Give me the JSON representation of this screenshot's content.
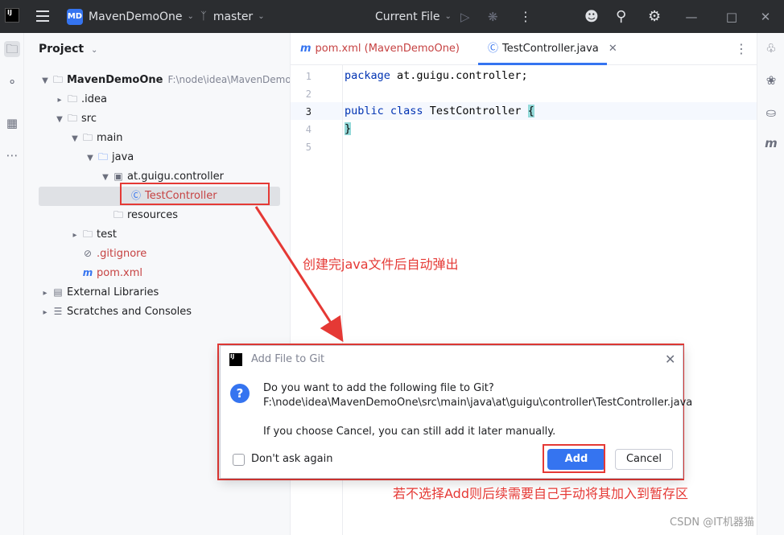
{
  "titlebar": {
    "app_badge": "MD",
    "project_name": "MavenDemoOne",
    "vcs_branch": "master",
    "run_config": "Current File",
    "icons": [
      "hamburger-icon",
      "branch-icon",
      "run-icon",
      "debug-icon",
      "more-icon",
      "add-user-icon",
      "search-icon",
      "gear-icon",
      "minimize-icon",
      "maximize-icon",
      "close-icon"
    ]
  },
  "project_pane": {
    "title": "Project",
    "tree": [
      {
        "label": "MavenDemoOne",
        "hint": "F:\\node\\idea\\MavenDemoOne"
      },
      {
        "label": ".idea"
      },
      {
        "label": "src"
      },
      {
        "label": "main"
      },
      {
        "label": "java"
      },
      {
        "label": "at.guigu.controller"
      },
      {
        "label": "TestController"
      },
      {
        "label": "resources"
      },
      {
        "label": "test"
      },
      {
        "label": ".gitignore"
      },
      {
        "label": "pom.xml"
      },
      {
        "label": "External Libraries"
      },
      {
        "label": "Scratches and Consoles"
      }
    ]
  },
  "editor": {
    "tabs": [
      {
        "label": "pom.xml (MavenDemoOne)"
      },
      {
        "label": "TestController.java"
      }
    ],
    "line_numbers": [
      "1",
      "2",
      "3",
      "4",
      "5"
    ],
    "lines": {
      "l1_kw": "package",
      "l1_rest": " at.guigu.controller;",
      "l3_kw1": "public",
      "l3_kw2": "class",
      "l3_name": " TestController ",
      "l3_brace": "{",
      "l4_brace": "}"
    }
  },
  "dialog": {
    "title": "Add File to Git",
    "question": "Do you want to add the following file to Git?",
    "file_path": "F:\\node\\idea\\MavenDemoOne\\src\\main\\java\\at\\guigu\\controller\\TestController.java",
    "note": "If you choose Cancel, you can still add it later manually.",
    "checkbox_label": "Don't ask again",
    "add_label": "Add",
    "cancel_label": "Cancel"
  },
  "annotations": {
    "auto_popup": "创建完java文件后自动弹出",
    "add_hint": "若不选择Add则后续需要自己手动将其加入到暂存区"
  },
  "watermark": "CSDN @IT机器猫",
  "colors": {
    "accent": "#3574f0",
    "annotation_red": "#e53935",
    "titlebar": "#2b2d30"
  }
}
